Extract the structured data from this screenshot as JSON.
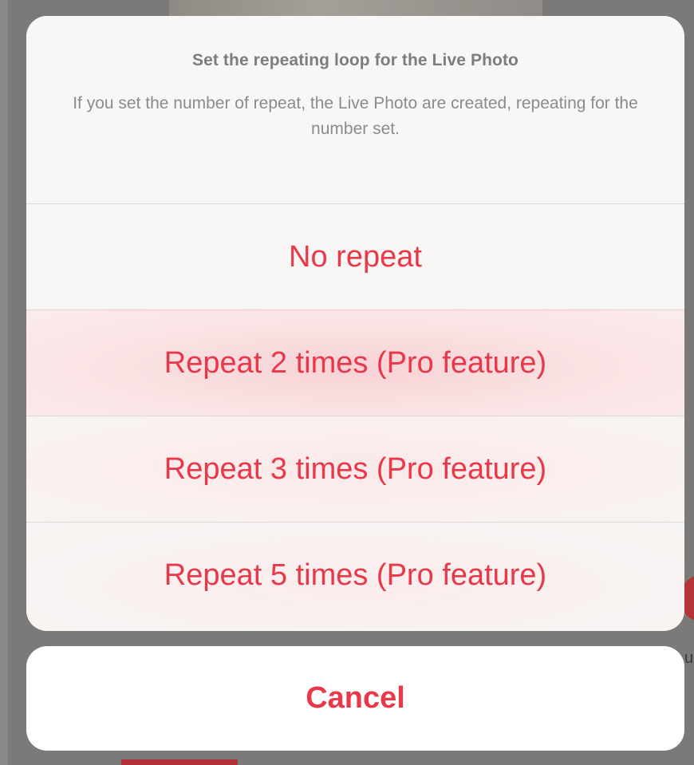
{
  "background": {
    "partial_text": "u"
  },
  "sheet": {
    "title": "Set the repeating loop for the Live Photo",
    "message": "If you set the number of repeat, the Live Photo are created, repeating for the number set.",
    "options": [
      {
        "label": "No repeat"
      },
      {
        "label": "Repeat 2 times (Pro feature)"
      },
      {
        "label": "Repeat 3 times (Pro feature)"
      },
      {
        "label": "Repeat 5 times (Pro feature)"
      }
    ],
    "cancel_label": "Cancel"
  },
  "colors": {
    "accent": "#e8384a",
    "title_text": "#7d7d7d",
    "message_text": "#8b8b8b",
    "sheet_bg": "#f7f6f4",
    "dim_overlay": "#7c7a78"
  }
}
